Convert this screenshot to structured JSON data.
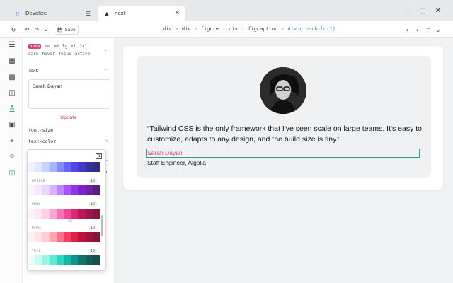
{
  "tabs": [
    {
      "label": "Devalize",
      "icon": "app-logo-icon"
    },
    {
      "label": "next",
      "icon": "triangle-icon"
    }
  ],
  "toolbar": {
    "save_label": "Save",
    "breadcrumb": [
      "div",
      "div",
      "figure",
      "div",
      "figcaption",
      "div:nth-child(1)"
    ]
  },
  "panel": {
    "breakpoints": [
      "none",
      "sm",
      "md",
      "lg",
      "xl",
      "2xl"
    ],
    "states": [
      "dark",
      "hover",
      "focus",
      "active"
    ],
    "section_title": "Text",
    "text_value": "Sarah Dayan",
    "update_label": "Update",
    "props": [
      "font-size",
      "text-color"
    ]
  },
  "palette": {
    "groups": [
      {
        "name": "",
        "num": "",
        "colors": [
          "#eef2ff",
          "#e0e7ff",
          "#c7d2fe",
          "#a5b4fc",
          "#818cf8",
          "#6366f1",
          "#4f46e5",
          "#4338ca",
          "#3730a3",
          "#312e81"
        ]
      },
      {
        "name": "PURPLE",
        "num": "10",
        "colors": [
          "#faf5ff",
          "#f3e8ff",
          "#e9d5ff",
          "#d8b4fe",
          "#c084fc",
          "#a855f7",
          "#9333ea",
          "#7e22ce",
          "#6b21a8",
          "#581c87"
        ]
      },
      {
        "name": "PINK",
        "num": "10",
        "colors": [
          "#fdf2f8",
          "#fce7f3",
          "#fbcfe8",
          "#f9a8d4",
          "#f472b6",
          "#ec4899",
          "#db2777",
          "#be185d",
          "#9d174d",
          "#831843"
        ]
      },
      {
        "name": "ROSE",
        "num": "10",
        "colors": [
          "#fff1f2",
          "#ffe4e6",
          "#fecdd3",
          "#fda4af",
          "#fb7185",
          "#f43f5e",
          "#e11d48",
          "#be123c",
          "#9f1239",
          "#881337"
        ]
      },
      {
        "name": "TEAL",
        "num": "10",
        "colors": [
          "#f0fdfa",
          "#ccfbf1",
          "#99f6e4",
          "#5eead4",
          "#2dd4bf",
          "#14b8a6",
          "#0d9488",
          "#0f766e",
          "#115e59",
          "#134e4a"
        ]
      }
    ]
  },
  "content": {
    "quote": "“Tailwind CSS is the only framework that I've seen scale on large teams. It's easy to customize, adapts to any design, and the build size is tiny.”",
    "name": "Sarah Dayan",
    "role": "Staff Engineer, Algolia"
  }
}
